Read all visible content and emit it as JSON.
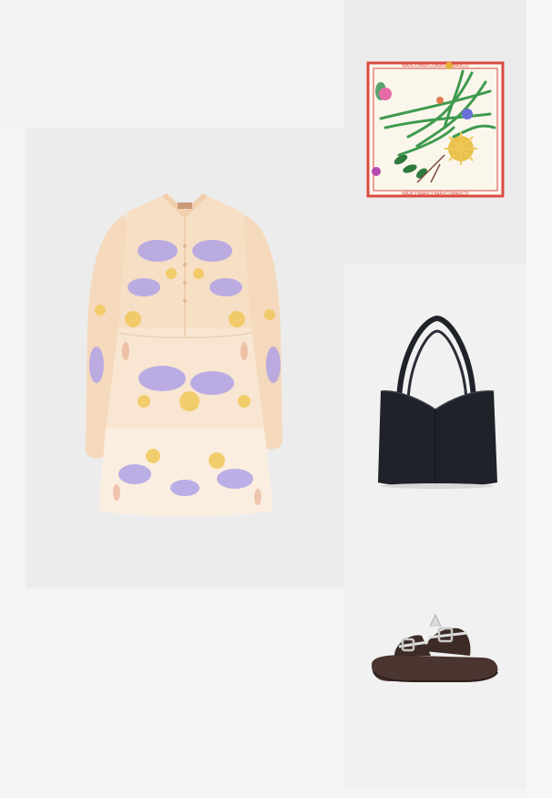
{
  "outfit": {
    "products": [
      {
        "id": "dress",
        "icon": "floral-mini-dress-image"
      },
      {
        "id": "scarf",
        "icon": "floral-silk-scarf-image"
      },
      {
        "id": "bag",
        "icon": "black-tote-bag-image"
      },
      {
        "id": "sandal",
        "icon": "brown-buckle-slide-sandal-image"
      }
    ],
    "scarf_border_text": "MAXCOMAXCOMAXCOMAXCO",
    "colors": {
      "dress_base": "#f6dcc0",
      "dress_flower_purple": "#a99ae0",
      "dress_flower_yellow": "#f0c85a",
      "scarf_border": "#d84a42",
      "scarf_leaf_green": "#3f9a4e",
      "bag": "#1f2229",
      "sandal_leather": "#4a3530",
      "sandal_buckle": "#c8c8c8"
    }
  }
}
